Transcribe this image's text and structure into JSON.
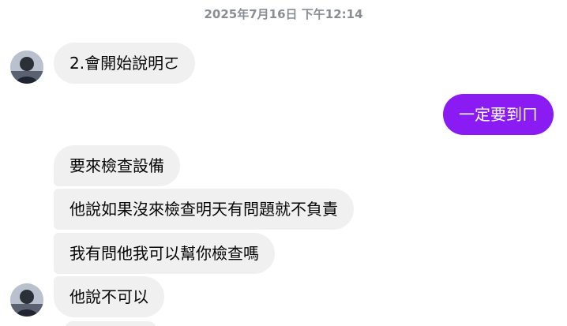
{
  "timestamp": "2025年7月16日 下午12:14",
  "messages": [
    {
      "text": "2.會開始說明ㄛ",
      "direction": "incoming"
    },
    {
      "text": "一定要到ㄇ",
      "direction": "outgoing"
    },
    {
      "text": "要來檢查設備",
      "direction": "incoming"
    },
    {
      "text": "他說如果沒來檢查明天有問題就不負責",
      "direction": "incoming"
    },
    {
      "text": "我有問他我可以幫你檢查嗎",
      "direction": "incoming"
    },
    {
      "text": "他說不可以",
      "direction": "incoming"
    }
  ],
  "colors": {
    "outgoing_bubble": "#8a1cf3",
    "incoming_bubble": "#f0f0f0",
    "timestamp_text": "#8a8d91"
  }
}
